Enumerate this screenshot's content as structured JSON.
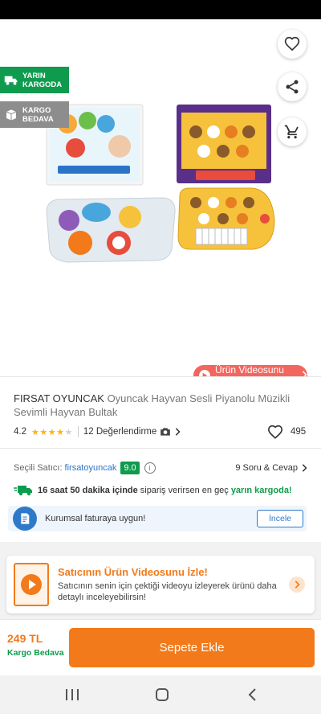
{
  "badges": {
    "tomorrow": "YARIN KARGODA",
    "free_shipping": "KARGO BEDAVA"
  },
  "video_pill": "Ürün Videosunu İzle",
  "product": {
    "brand": "FIRSAT OYUNCAK",
    "name": "Oyuncak Hayvan Sesli Piyanolu Müzikli Sevimli Hayvan Bultak",
    "rating": "4.2",
    "rating_stars": 4,
    "reviews": "12 Değerlendirme",
    "favorites": "495"
  },
  "seller": {
    "label": "Seçili Satıcı:",
    "name": "firsatoyuncak",
    "score": "9.0",
    "qa": "9 Soru & Cevap"
  },
  "delivery": {
    "time": "16 saat 50 dakika içinde",
    "middle": "sipariş verirsen en geç",
    "highlight": "yarın kargoda!"
  },
  "corporate": {
    "text": "Kurumsal faturaya uygun!",
    "button": "İncele"
  },
  "video_card": {
    "title": "Satıcının Ürün Videosunu İzle!",
    "subtitle": "Satıcının senin için çektiği videoyu izleyerek ürünü daha detaylı inceleyebilirsin!"
  },
  "bottom": {
    "price": "249 TL",
    "shipping": "Kargo Bedava",
    "add_to_cart": "Sepete Ekle"
  },
  "colors": {
    "accent": "#f27a1a",
    "green": "#0f9b4e",
    "blue": "#2f7ac8"
  },
  "icons": [
    "back-arrow-icon",
    "heart-icon",
    "share-icon",
    "cart-icon",
    "truck-icon",
    "box-icon",
    "play-icon",
    "info-icon",
    "invoice-icon",
    "video-icon",
    "chevron-right-icon"
  ]
}
